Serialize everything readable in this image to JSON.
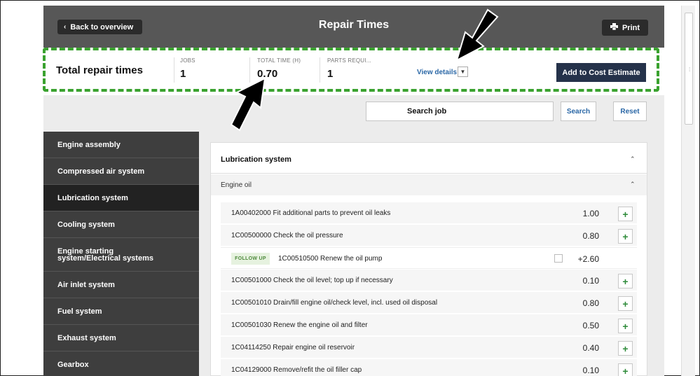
{
  "header": {
    "back_label": "Back to overview",
    "title": "Repair Times",
    "print_label": "Print"
  },
  "summary": {
    "title": "Total repair times",
    "stats": [
      {
        "label": "JOBS",
        "value": "1"
      },
      {
        "label": "TOTAL TIME (H)",
        "value": "0.70"
      },
      {
        "label": "PARTS REQUI...",
        "value": "1"
      }
    ],
    "view_details": "View details",
    "add_cost": "Add to Cost Estimate"
  },
  "search": {
    "placeholder": "Search job",
    "search_label": "Search",
    "reset_label": "Reset"
  },
  "sidebar": {
    "items": [
      {
        "label": "Engine assembly"
      },
      {
        "label": "Compressed air system"
      },
      {
        "label": "Lubrication system"
      },
      {
        "label": "Cooling system"
      },
      {
        "label": "Engine starting system/Electrical systems"
      },
      {
        "label": "Air inlet system"
      },
      {
        "label": "Fuel system"
      },
      {
        "label": "Exhaust system"
      },
      {
        "label": "Gearbox"
      }
    ],
    "active_index": 2
  },
  "content": {
    "section_title": "Lubrication system",
    "subsection_title": "Engine oil",
    "follow_up_label": "FOLLOW UP",
    "rows": [
      {
        "job": "1A00402000 Fit additional parts to prevent oil leaks",
        "time": "1.00"
      },
      {
        "job": "1C00500000 Check the oil pressure",
        "time": "0.80"
      },
      {
        "job": "1C00510500 Renew the oil pump",
        "time": "+2.60",
        "follow_up": true
      },
      {
        "job": "1C00501000 Check the oil level; top up if necessary",
        "time": "0.10"
      },
      {
        "job": "1C00501010 Drain/fill engine oil/check level, incl. used oil disposal",
        "time": "0.80"
      },
      {
        "job": "1C00501030 Renew the engine oil and filter",
        "time": "0.50"
      },
      {
        "job": "1C04114250 Repair engine oil reservoir",
        "time": "0.40"
      },
      {
        "job": "1C04129000 Remove/refit the oil filler cap",
        "time": "0.10"
      }
    ]
  },
  "icons": {
    "back": "chevron-left-icon",
    "print": "printer-icon",
    "expand": "chevron-down-icon",
    "collapse": "chevron-up-icon",
    "add": "plus-icon"
  },
  "colors": {
    "header_bg": "#575757",
    "accent_blue": "#2a67a6",
    "cta_navy": "#25324a",
    "highlight_green": "#3aa22f",
    "add_green": "#2e8b3a"
  }
}
